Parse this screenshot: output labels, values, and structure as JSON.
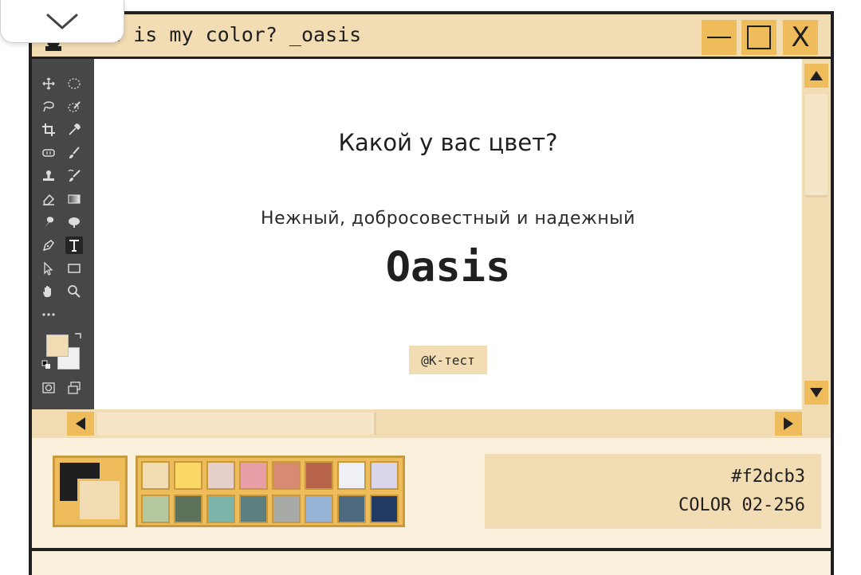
{
  "window": {
    "title": "What is my color? _oasis",
    "close_label": "X"
  },
  "canvas": {
    "question": "Какой у вас цвет?",
    "subtitle": "Нежный, добросовестный и надежный",
    "color_name": "Oasis",
    "credit": "@K-тест"
  },
  "info": {
    "hex": "#f2dcb3",
    "index": "COLOR 02-256"
  },
  "palette": {
    "foreground": "#1f1f1f",
    "background": "#f2dcb3",
    "swatches": [
      "#f2dcb3",
      "#fbd866",
      "#e7cfca",
      "#e99fa8",
      "#d98a72",
      "#b8644a",
      "#eef0f6",
      "#d9d6ec",
      "#b6c8a0",
      "#5b7159",
      "#7db5aa",
      "#5e7f7f",
      "#a8aaa8",
      "#96b3d6",
      "#4e6a80",
      "#233b63"
    ]
  },
  "colors": {
    "accent": "#efbc5c",
    "panel": "#f2dcb3",
    "frame": "#1f1f1f",
    "toolbox": "#474747"
  },
  "icons": {
    "collapse": "chevron-down-icon",
    "window": "app-icon",
    "minimize": "minimize-icon",
    "maximize": "maximize-icon",
    "close": "close-icon",
    "tools": [
      "move-tool-icon",
      "ellipse-marquee-tool-icon",
      "lasso-tool-icon",
      "quick-select-tool-icon",
      "crop-tool-icon",
      "eyedropper-tool-icon",
      "healing-tool-icon",
      "brush-tool-icon",
      "stamp-tool-icon",
      "history-brush-tool-icon",
      "eraser-tool-icon",
      "gradient-tool-icon",
      "smudge-tool-icon",
      "dodge-tool-icon",
      "pen-tool-icon",
      "type-tool-icon",
      "path-select-tool-icon",
      "rectangle-tool-icon",
      "hand-tool-icon",
      "zoom-tool-icon",
      "more-tools-icon"
    ]
  }
}
